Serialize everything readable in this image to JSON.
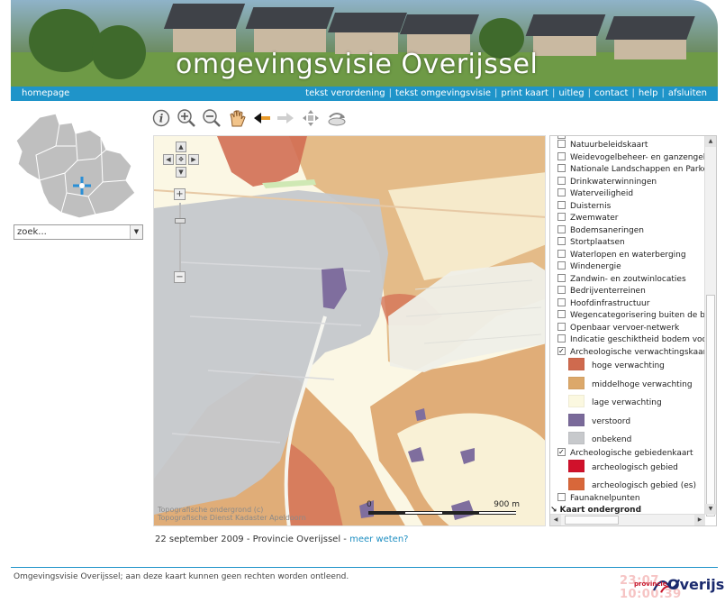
{
  "header": {
    "title": "omgevingsvisie Overijssel"
  },
  "nav": {
    "home": "homepage",
    "links": [
      "tekst verordening",
      "tekst omgevingsvisie",
      "print kaart",
      "uitleg",
      "contact",
      "help",
      "afsluiten"
    ]
  },
  "search": {
    "value": "zoek..."
  },
  "toolbar": {
    "tools": [
      "info-icon",
      "zoom-in-icon",
      "zoom-out-icon",
      "pan-hand-icon",
      "back-arrow-icon",
      "forward-arrow-icon",
      "full-extent-icon",
      "reset-view-icon"
    ]
  },
  "map": {
    "copyright_line1": "Topografische ondergrond (c)",
    "copyright_line2": "Topografische Dienst Kadaster Apeldoorn",
    "scale_start": "0",
    "scale_end": "900 m"
  },
  "layers": {
    "items": [
      {
        "label": "Natuurbeleidskaart",
        "checked": false
      },
      {
        "label": "Weidevogelbeheer- en ganzengebieden",
        "checked": false
      },
      {
        "label": "Nationale Landschappen en Parken",
        "checked": false
      },
      {
        "label": "Drinkwaterwinningen",
        "checked": false
      },
      {
        "label": "Waterveiligheid",
        "checked": false
      },
      {
        "label": "Duisternis",
        "checked": false
      },
      {
        "label": "Zwemwater",
        "checked": false
      },
      {
        "label": "Bodemsaneringen",
        "checked": false
      },
      {
        "label": "Stortplaatsen",
        "checked": false
      },
      {
        "label": "Waterlopen en waterberging",
        "checked": false
      },
      {
        "label": "Windenergie",
        "checked": false
      },
      {
        "label": "Zandwin- en zoutwinlocaties",
        "checked": false
      },
      {
        "label": "Bedrijventerreinen",
        "checked": false
      },
      {
        "label": "Hoofdinfrastructuur",
        "checked": false
      },
      {
        "label": "Wegencategorisering buiten de bebouwde kom",
        "checked": false
      },
      {
        "label": "Openbaar vervoer-netwerk",
        "checked": false
      },
      {
        "label": "Indicatie geschiktheid bodem voor",
        "checked": false
      },
      {
        "label": "Archeologische verwachtingskaart",
        "checked": true
      }
    ],
    "legend_verwachting": [
      {
        "label": "hoge verwachting",
        "color": "#cf6a4e"
      },
      {
        "label": "middelhoge verwachting",
        "color": "#dca86a"
      },
      {
        "label": "lage verwachting",
        "color": "#fbf8e0"
      },
      {
        "label": "verstoord",
        "color": "#7a6a9a"
      },
      {
        "label": "onbekend",
        "color": "#c7c9cc"
      }
    ],
    "gebieden": {
      "label": "Archeologische gebiedenkaart",
      "checked": true
    },
    "legend_gebieden": [
      {
        "label": "archeologisch gebied",
        "color": "#d0112b"
      },
      {
        "label": "archeologisch gebied (es)",
        "color": "#d8673a"
      }
    ],
    "fauna": {
      "label": "Faunaknelpunten",
      "checked": false
    },
    "ondergrond": "Kaart ondergrond"
  },
  "caption": {
    "text": "22 september 2009 - Provincie Overijssel - ",
    "link": "meer weten?"
  },
  "footer": {
    "disclaimer": "Omgevingsvisie Overijssel; aan deze kaart kunnen geen rechten worden ontleend.",
    "time": "23:07",
    "time2": "10:00:39",
    "logo_sub": "provincie",
    "logo_main": "Overijssel"
  },
  "colors": {
    "nav_blue": "#1f94c9",
    "hoge": "#cf6a4e",
    "middelhoge": "#dca86a",
    "lage": "#fbf8e0",
    "verstoord": "#7a6a9a",
    "onbekend": "#c7c9cc"
  }
}
